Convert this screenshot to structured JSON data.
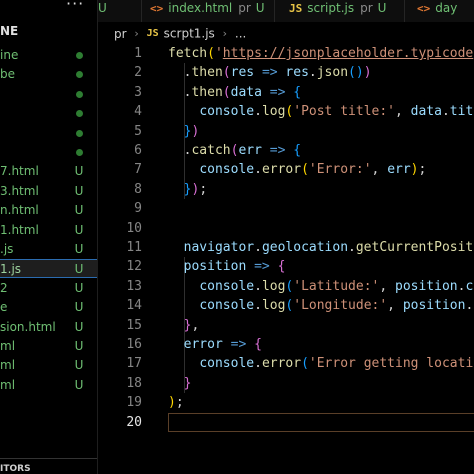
{
  "sidebar": {
    "header": "NE",
    "items": [
      {
        "name": "ine",
        "status": "dot"
      },
      {
        "name": "be",
        "status": "dot"
      },
      {
        "name": "",
        "status": "dot"
      },
      {
        "name": "",
        "status": "dot"
      },
      {
        "name": "",
        "status": "dot"
      },
      {
        "name": "",
        "status": "dot"
      },
      {
        "name": "7.html",
        "status": "U"
      },
      {
        "name": "3.html",
        "status": "U"
      },
      {
        "name": "n.html",
        "status": "U"
      },
      {
        "name": "1.html",
        "status": "U"
      },
      {
        "name": ".js",
        "status": "U"
      },
      {
        "name": "1.js",
        "status": "U",
        "active": true
      },
      {
        "name": "2",
        "status": "U"
      },
      {
        "name": "e",
        "status": "U"
      },
      {
        "name": "sion.html",
        "status": "U"
      },
      {
        "name": "ml",
        "status": "U"
      },
      {
        "name": "ml",
        "status": "U"
      },
      {
        "name": "ml",
        "status": "U"
      }
    ],
    "footer": "ITORS"
  },
  "tabs": [
    {
      "icon": "",
      "name": "",
      "suffix": "U"
    },
    {
      "icon": "<>",
      "name": "index.html",
      "meta": "pr",
      "suffix": "U"
    },
    {
      "icon": "JS",
      "name": "script.js",
      "meta": "pr",
      "suffix": "U"
    },
    {
      "icon": "<>",
      "name": "day",
      "meta": "",
      "suffix": ""
    }
  ],
  "breadcrumb": {
    "folder": "pr",
    "icon": "JS",
    "file": "scrpt1.js",
    "ellipsis": "..."
  },
  "editor": {
    "current_line": 20,
    "accent_border": "#5a3f28"
  },
  "code_lines": [
    [
      {
        "c": "t-fn",
        "t": "fetch"
      },
      {
        "c": "t-p1",
        "t": "("
      },
      {
        "c": "t-str",
        "t": "'"
      },
      {
        "c": "t-url",
        "t": "https://jsonplaceholder.typicode"
      }
    ],
    [
      {
        "c": "t-op",
        "t": "  ."
      },
      {
        "c": "t-fn",
        "t": "then"
      },
      {
        "c": "t-p2",
        "t": "("
      },
      {
        "c": "t-var",
        "t": "res"
      },
      {
        "c": "t-op",
        "t": " "
      },
      {
        "c": "t-kw",
        "t": "=>"
      },
      {
        "c": "t-op",
        "t": " "
      },
      {
        "c": "t-var",
        "t": "res"
      },
      {
        "c": "t-op",
        "t": "."
      },
      {
        "c": "t-fn",
        "t": "json"
      },
      {
        "c": "t-p3",
        "t": "()"
      },
      {
        "c": "t-p2",
        "t": ")"
      }
    ],
    [
      {
        "c": "t-op",
        "t": "  ."
      },
      {
        "c": "t-fn",
        "t": "then"
      },
      {
        "c": "t-p2",
        "t": "("
      },
      {
        "c": "t-var",
        "t": "data"
      },
      {
        "c": "t-op",
        "t": " "
      },
      {
        "c": "t-kw",
        "t": "=>"
      },
      {
        "c": "t-op",
        "t": " "
      },
      {
        "c": "t-p3",
        "t": "{"
      }
    ],
    [
      {
        "c": "t-op",
        "t": "    "
      },
      {
        "c": "t-var",
        "t": "console"
      },
      {
        "c": "t-op",
        "t": "."
      },
      {
        "c": "t-fn",
        "t": "log"
      },
      {
        "c": "t-p1",
        "t": "("
      },
      {
        "c": "t-str",
        "t": "'Post title:'"
      },
      {
        "c": "t-op",
        "t": ", "
      },
      {
        "c": "t-var",
        "t": "data"
      },
      {
        "c": "t-op",
        "t": "."
      },
      {
        "c": "t-var",
        "t": "tit"
      }
    ],
    [
      {
        "c": "t-op",
        "t": "  "
      },
      {
        "c": "t-p3",
        "t": "}"
      },
      {
        "c": "t-p2",
        "t": ")"
      }
    ],
    [
      {
        "c": "t-op",
        "t": "  ."
      },
      {
        "c": "t-fn",
        "t": "catch"
      },
      {
        "c": "t-p2",
        "t": "("
      },
      {
        "c": "t-var",
        "t": "err"
      },
      {
        "c": "t-op",
        "t": " "
      },
      {
        "c": "t-kw",
        "t": "=>"
      },
      {
        "c": "t-op",
        "t": " "
      },
      {
        "c": "t-p3",
        "t": "{"
      }
    ],
    [
      {
        "c": "t-op",
        "t": "    "
      },
      {
        "c": "t-var",
        "t": "console"
      },
      {
        "c": "t-op",
        "t": "."
      },
      {
        "c": "t-fn",
        "t": "error"
      },
      {
        "c": "t-p1",
        "t": "("
      },
      {
        "c": "t-str",
        "t": "'Error:'"
      },
      {
        "c": "t-op",
        "t": ", "
      },
      {
        "c": "t-var",
        "t": "err"
      },
      {
        "c": "t-p1",
        "t": ")"
      },
      {
        "c": "t-op",
        "t": ";"
      }
    ],
    [
      {
        "c": "t-op",
        "t": "  "
      },
      {
        "c": "t-p3",
        "t": "}"
      },
      {
        "c": "t-p2",
        "t": ")"
      },
      {
        "c": "t-op",
        "t": ";"
      }
    ],
    [],
    [],
    [
      {
        "c": "t-op",
        "t": "  "
      },
      {
        "c": "t-var",
        "t": "navigator"
      },
      {
        "c": "t-op",
        "t": "."
      },
      {
        "c": "t-var",
        "t": "geolocation"
      },
      {
        "c": "t-op",
        "t": "."
      },
      {
        "c": "t-fn",
        "t": "getCurrentPositi"
      }
    ],
    [
      {
        "c": "t-op",
        "t": "  "
      },
      {
        "c": "t-var",
        "t": "position"
      },
      {
        "c": "t-op",
        "t": " "
      },
      {
        "c": "t-kw",
        "t": "=>"
      },
      {
        "c": "t-op",
        "t": " "
      },
      {
        "c": "t-p2",
        "t": "{"
      }
    ],
    [
      {
        "c": "t-op",
        "t": "    "
      },
      {
        "c": "t-var",
        "t": "console"
      },
      {
        "c": "t-op",
        "t": "."
      },
      {
        "c": "t-fn",
        "t": "log"
      },
      {
        "c": "t-p3",
        "t": "("
      },
      {
        "c": "t-str",
        "t": "'Latitude:'"
      },
      {
        "c": "t-op",
        "t": ", "
      },
      {
        "c": "t-var",
        "t": "position"
      },
      {
        "c": "t-op",
        "t": "."
      },
      {
        "c": "t-var",
        "t": "c"
      }
    ],
    [
      {
        "c": "t-op",
        "t": "    "
      },
      {
        "c": "t-var",
        "t": "console"
      },
      {
        "c": "t-op",
        "t": "."
      },
      {
        "c": "t-fn",
        "t": "log"
      },
      {
        "c": "t-p3",
        "t": "("
      },
      {
        "c": "t-str",
        "t": "'Longitude:'"
      },
      {
        "c": "t-op",
        "t": ", "
      },
      {
        "c": "t-var",
        "t": "position"
      },
      {
        "c": "t-op",
        "t": "."
      }
    ],
    [
      {
        "c": "t-op",
        "t": "  "
      },
      {
        "c": "t-p2",
        "t": "}"
      },
      {
        "c": "t-op",
        "t": ","
      }
    ],
    [
      {
        "c": "t-op",
        "t": "  "
      },
      {
        "c": "t-var",
        "t": "error"
      },
      {
        "c": "t-op",
        "t": " "
      },
      {
        "c": "t-kw",
        "t": "=>"
      },
      {
        "c": "t-op",
        "t": " "
      },
      {
        "c": "t-p2",
        "t": "{"
      }
    ],
    [
      {
        "c": "t-op",
        "t": "    "
      },
      {
        "c": "t-var",
        "t": "console"
      },
      {
        "c": "t-op",
        "t": "."
      },
      {
        "c": "t-fn",
        "t": "error"
      },
      {
        "c": "t-p3",
        "t": "("
      },
      {
        "c": "t-str",
        "t": "'Error getting locati"
      }
    ],
    [
      {
        "c": "t-op",
        "t": "  "
      },
      {
        "c": "t-p2",
        "t": "}"
      }
    ],
    [
      {
        "c": "t-p1",
        "t": ")"
      },
      {
        "c": "t-op",
        "t": ";"
      }
    ],
    []
  ]
}
